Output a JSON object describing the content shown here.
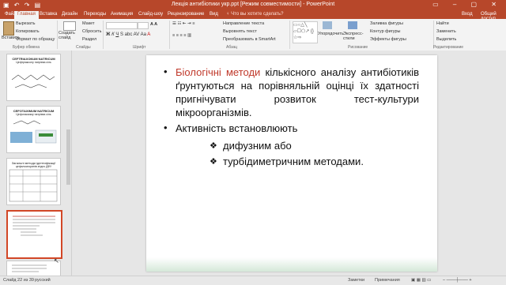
{
  "window": {
    "title": "Лекція антибіотики укр.ppt [Режим совместимости] - PowerPoint"
  },
  "tabs": [
    "Файл",
    "Главная",
    "Вставка",
    "Дизайн",
    "Переходы",
    "Анимация",
    "Слайд-шоу",
    "Рецензирование",
    "Вид"
  ],
  "tell_me": "♀ Что вы хотите сделать?",
  "account": {
    "login": "Вход",
    "share": "Общий доступ"
  },
  "ribbon": {
    "clipboard": {
      "paste": "Вставить",
      "cut": "Вырезать",
      "copy": "Копировать",
      "format_painter": "Формат по образцу",
      "group": "Буфер обмена"
    },
    "slides": {
      "create": "Создать слайд",
      "layout": "Макет",
      "reset": "Сбросить",
      "section": "Раздел",
      "group": "Слайды"
    },
    "font": {
      "group": "Шрифт"
    },
    "paragraph": {
      "direction": "Направление текста",
      "align": "Выровнять текст",
      "smartart": "Преобразовать в SmartArt",
      "group": "Абзац"
    },
    "drawing": {
      "arrange": "Упорядочить",
      "quick_styles": "Экспресс-стили",
      "fill": "Заливка фигуры",
      "outline": "Контур фигуры",
      "effects": "Эффекты фигуры",
      "group": "Рисование"
    },
    "editing": {
      "find": "Найти",
      "replace": "Заменить",
      "select": "Выделить",
      "group": "Редактирование"
    }
  },
  "thumbnails": [
    {
      "title": "CEFTRIAXONUM NATRICUM",
      "subtitle": "Цефтріаксону натрієва сіль"
    },
    {
      "title": "CEFOTAXIMUM NATRICUM",
      "subtitle": "Цефотаксиму натрієва сіль"
    },
    {
      "title": "Загальні методи ідентифікації",
      "subtitle": "цефалоспоринів згідно ДФУ"
    }
  ],
  "slide": {
    "p1_red": "Біологічні методи",
    "p1_rest": " кількісного аналізу антибіотиків ґрунтуються на порівняльній оцінці їх здатності пригнічувати розвиток тест-культури мікроорганізмів.",
    "p2": "Активність встановлюють",
    "sub1": "дифузним або",
    "sub2": "турбідиметричним методами."
  },
  "status": {
    "slide_counter": "Слайд 22 из 39",
    "language": "русский",
    "notes": "Заметки",
    "comments": "Примечания"
  }
}
